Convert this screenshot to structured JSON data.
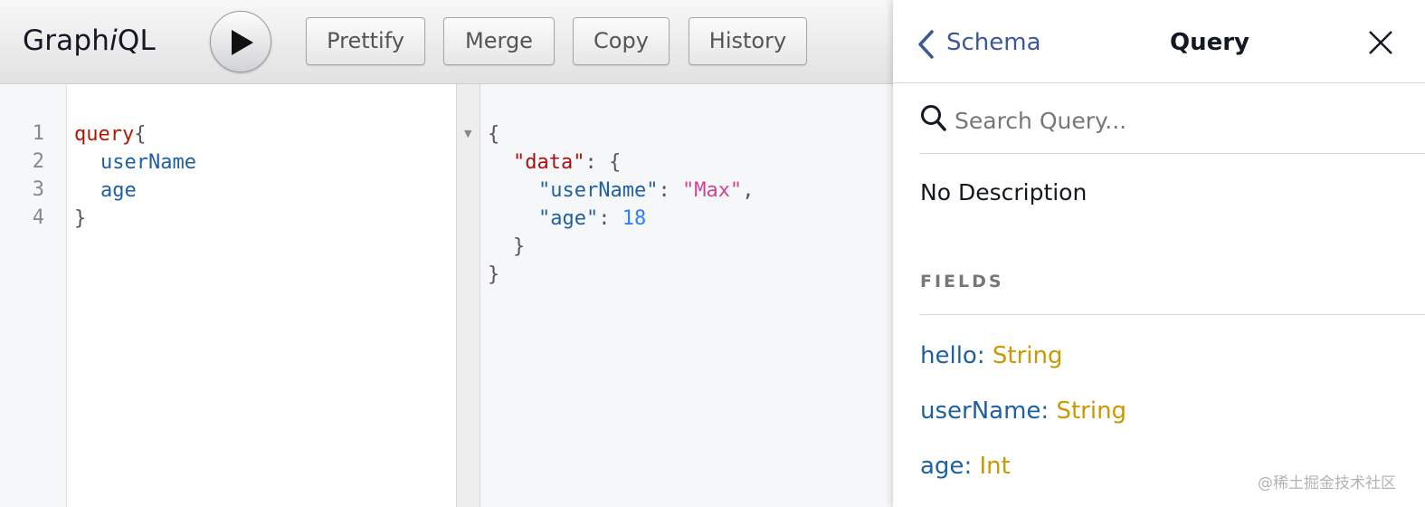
{
  "app": {
    "logo_prefix": "Graph",
    "logo_italic": "i",
    "logo_suffix": "QL"
  },
  "toolbar": {
    "run_icon": "play-icon",
    "buttons": [
      {
        "label": "Prettify"
      },
      {
        "label": "Merge"
      },
      {
        "label": "Copy"
      },
      {
        "label": "History"
      }
    ]
  },
  "query_editor": {
    "line_numbers": [
      "1",
      "2",
      "3",
      "4"
    ],
    "lines": [
      {
        "keyword": "query",
        "brace": "{"
      },
      {
        "field": "userName"
      },
      {
        "field": "age"
      },
      {
        "brace": "}"
      }
    ]
  },
  "result": {
    "open_brace": "{",
    "data_key": "\"data\"",
    "data_sep": ": {",
    "username_key": "\"userName\"",
    "username_sep": ": ",
    "username_value": "\"Max\"",
    "username_comma": ",",
    "age_key": "\"age\"",
    "age_sep": ": ",
    "age_value": "18",
    "inner_close": "}",
    "outer_close": "}",
    "fold_icon": "fold-arrow-icon"
  },
  "docs": {
    "back_label": "Schema",
    "title": "Query",
    "search_placeholder": "Search Query...",
    "description": "No Description",
    "section_title": "FIELDS",
    "fields": [
      {
        "name": "hello",
        "type": "String"
      },
      {
        "name": "userName",
        "type": "String"
      },
      {
        "name": "age",
        "type": "Int"
      }
    ]
  },
  "watermark": "@稀土掘金技术社区",
  "colors": {
    "keyword": "#b11a04",
    "field": "#1f61a0",
    "string": "#d64292",
    "number": "#2882f9",
    "type": "#ca9800",
    "link": "#3b5998"
  }
}
